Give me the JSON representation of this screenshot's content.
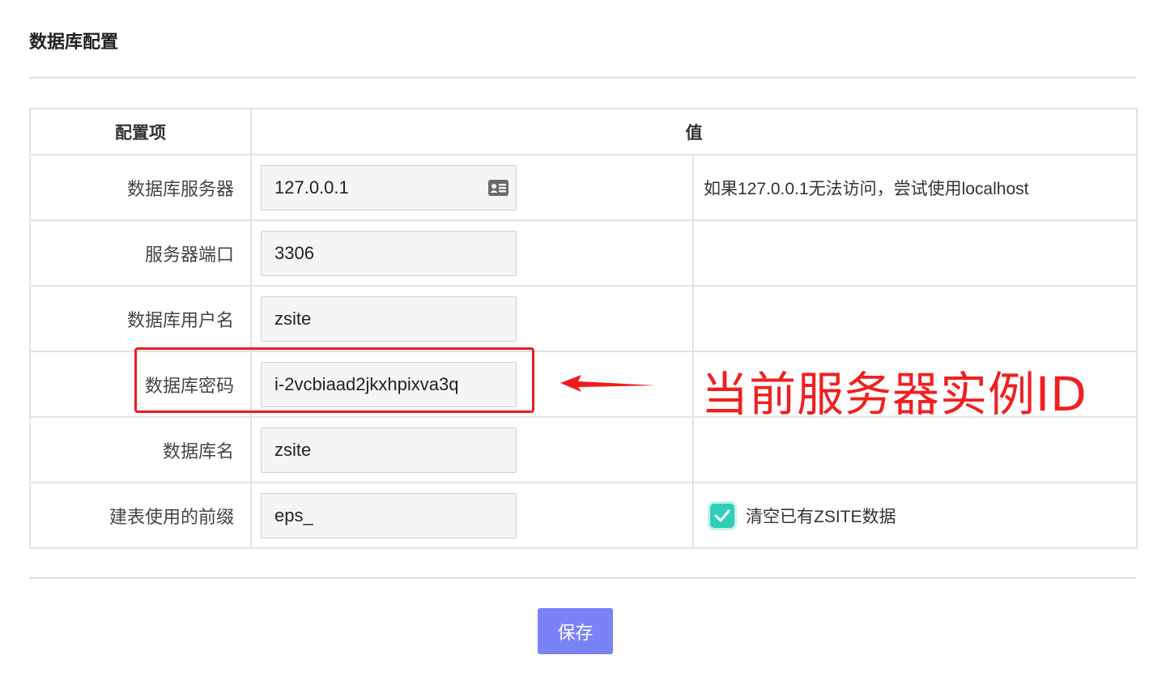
{
  "page": {
    "title": "数据库配置"
  },
  "table": {
    "headers": [
      "配置项",
      "值"
    ],
    "rows": [
      {
        "label": "数据库服务器",
        "value": "127.0.0.1",
        "note": "如果127.0.0.1无法访问，尝试使用localhost",
        "icon": "contact-card-icon"
      },
      {
        "label": "服务器端口",
        "value": "3306",
        "note": ""
      },
      {
        "label": "数据库用户名",
        "value": "zsite",
        "note": ""
      },
      {
        "label": "数据库密码",
        "value": "i-2vcbiaad2jkxhpixva3q",
        "note": ""
      },
      {
        "label": "数据库名",
        "value": "zsite",
        "note": ""
      },
      {
        "label": "建表使用的前缀",
        "value": "eps_",
        "checkbox": {
          "label": "清空已有ZSITE数据",
          "checked": true
        }
      }
    ]
  },
  "actions": {
    "save_label": "保存"
  },
  "annotation": {
    "text": "当前服务器实例ID",
    "color": "#f02020"
  },
  "colors": {
    "accent": "#7b82f7",
    "checkbox": "#2ecfb8",
    "annotation": "#ee1c1c"
  }
}
